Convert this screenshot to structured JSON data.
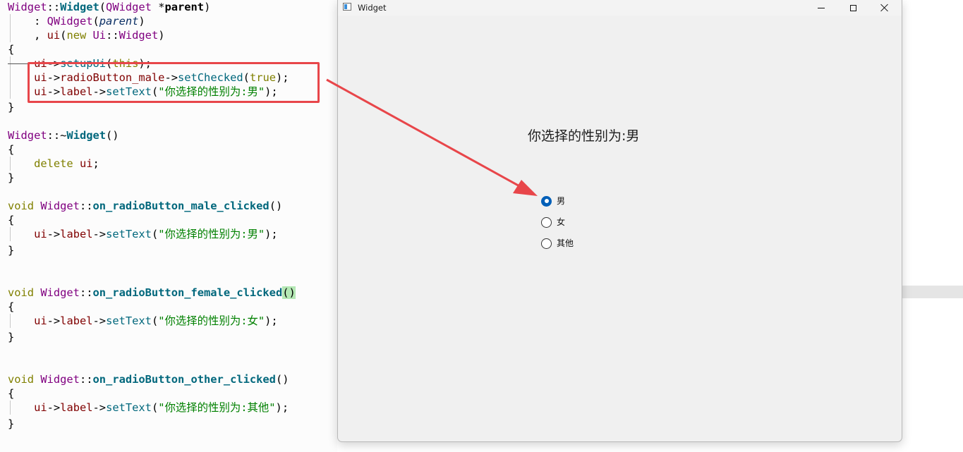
{
  "editor": {
    "lines": {
      "l1": {
        "t1": "Widget",
        "t2": "::",
        "t3": "Widget",
        "t4": "(",
        "t5": "QWidget",
        "t6": " *",
        "t7": "parent",
        "t8": ")"
      },
      "l2": {
        "t1": "    : ",
        "t2": "QWidget",
        "t3": "(",
        "t4": "parent",
        "t5": ")"
      },
      "l3": {
        "t1": "    , ",
        "t2": "ui",
        "t3": "(",
        "t4": "new ",
        "t5": "Ui",
        "t6": "::",
        "t7": "Widget",
        "t8": ")"
      },
      "l4": {
        "t1": "{"
      },
      "l5": {
        "t1": "    ",
        "t2": "ui",
        "t3": "->",
        "t4": "setupUi",
        "t5": "(",
        "t6": "this",
        "t7": ");"
      },
      "l6": {
        "t1": "    ",
        "t2": "ui",
        "t3": "->",
        "t4": "radioButton_male",
        "t5": "->",
        "t6": "setChecked",
        "t7": "(",
        "t8": "true",
        "t9": ");"
      },
      "l7": {
        "t1": "    ",
        "t2": "ui",
        "t3": "->",
        "t4": "label",
        "t5": "->",
        "t6": "setText",
        "t7": "(",
        "t8": "\"你选择的性别为:男\"",
        "t9": ");"
      },
      "l8": {
        "t1": "}"
      },
      "l9": {
        "t1": "Widget",
        "t2": "::~",
        "t3": "Widget",
        "t4": "()"
      },
      "l10": {
        "t1": "{"
      },
      "l11": {
        "t1": "    ",
        "t2": "delete ",
        "t3": "ui",
        "t4": ";"
      },
      "l12": {
        "t1": "}"
      },
      "l13": {
        "t1": "void ",
        "t2": "Widget",
        "t3": "::",
        "t4": "on_radioButton_male_clicked",
        "t5": "()"
      },
      "l14": {
        "t1": "{"
      },
      "l15": {
        "t1": "    ",
        "t2": "ui",
        "t3": "->",
        "t4": "label",
        "t5": "->",
        "t6": "setText",
        "t7": "(",
        "t8": "\"你选择的性别为:男\"",
        "t9": ");"
      },
      "l16": {
        "t1": "}"
      },
      "l17": {
        "t1": "void ",
        "t2": "Widget",
        "t3": "::",
        "t4": "on_radioButton_female_clicked",
        "t5": "()"
      },
      "l18": {
        "t1": "{"
      },
      "l19": {
        "t1": "    ",
        "t2": "ui",
        "t3": "->",
        "t4": "label",
        "t5": "->",
        "t6": "setText",
        "t7": "(",
        "t8": "\"你选择的性别为:女\"",
        "t9": ");"
      },
      "l20": {
        "t1": "}"
      },
      "l21": {
        "t1": "void ",
        "t2": "Widget",
        "t3": "::",
        "t4": "on_radioButton_other_clicked",
        "t5": "()"
      },
      "l22": {
        "t1": "{"
      },
      "l23": {
        "t1": "    ",
        "t2": "ui",
        "t3": "->",
        "t4": "label",
        "t5": "->",
        "t6": "setText",
        "t7": "(",
        "t8": "\"你选择的性别为:其他\"",
        "t9": ");"
      },
      "l24": {
        "t1": "}"
      }
    }
  },
  "window": {
    "title": "Widget",
    "controls": {
      "minimize": "minimize-icon",
      "maximize": "maximize-icon",
      "close": "close-icon"
    },
    "label_text": "你选择的性别为:男",
    "radios": [
      {
        "label": "男",
        "checked": true
      },
      {
        "label": "女",
        "checked": false
      },
      {
        "label": "其他",
        "checked": false
      }
    ]
  },
  "colors": {
    "annotation_red": "#e8464a",
    "radio_accent": "#005fb8",
    "string_green": "#008000",
    "type_purple": "#800080"
  }
}
